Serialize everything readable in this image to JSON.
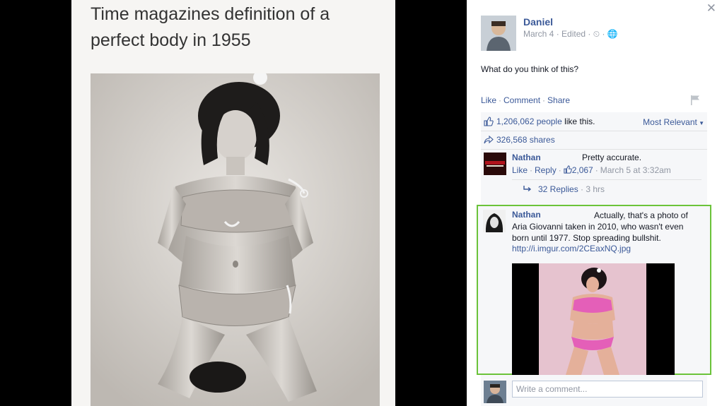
{
  "meme": {
    "title": "Time magazines definition of a perfect body in 1955"
  },
  "post": {
    "author": "Daniel",
    "date": "March 4",
    "edited": "Edited",
    "text": "What do you think of this?",
    "actions": {
      "like": "Like",
      "comment": "Comment",
      "share": "Share"
    },
    "likes_count": "1,206,062 people",
    "likes_suffix": " like this.",
    "sort_label": "Most Relevant",
    "shares": "326,568 shares"
  },
  "comments": [
    {
      "author": "Nathan",
      "text": "Pretty accurate.",
      "like": "Like",
      "reply": "Reply",
      "like_count": "2,067",
      "time": "March 5 at 3:32am",
      "replies": "32 Replies",
      "replies_time": "3 hrs"
    },
    {
      "author": "Nathan",
      "text": "Actually, that's a photo of Aria Giovanni taken in 2010, who wasn't even born until 1977. Stop spreading bullshit.",
      "link": "http://i.imgur.com/2CEaxNQ.jpg"
    }
  ],
  "composer": {
    "placeholder": "Write a comment..."
  },
  "icons": {
    "close": "close-icon",
    "clock": "clock-icon",
    "globe": "globe-icon",
    "flag": "flag-icon",
    "thumb": "thumbs-up-icon",
    "share": "share-arrow-icon",
    "reply": "reply-arrow-icon",
    "caret": "caret-down-icon"
  },
  "colors": {
    "link": "#3b5998",
    "muted": "#9197a3",
    "highlight": "#6bc33a",
    "panel_bg": "#f6f7f9"
  }
}
